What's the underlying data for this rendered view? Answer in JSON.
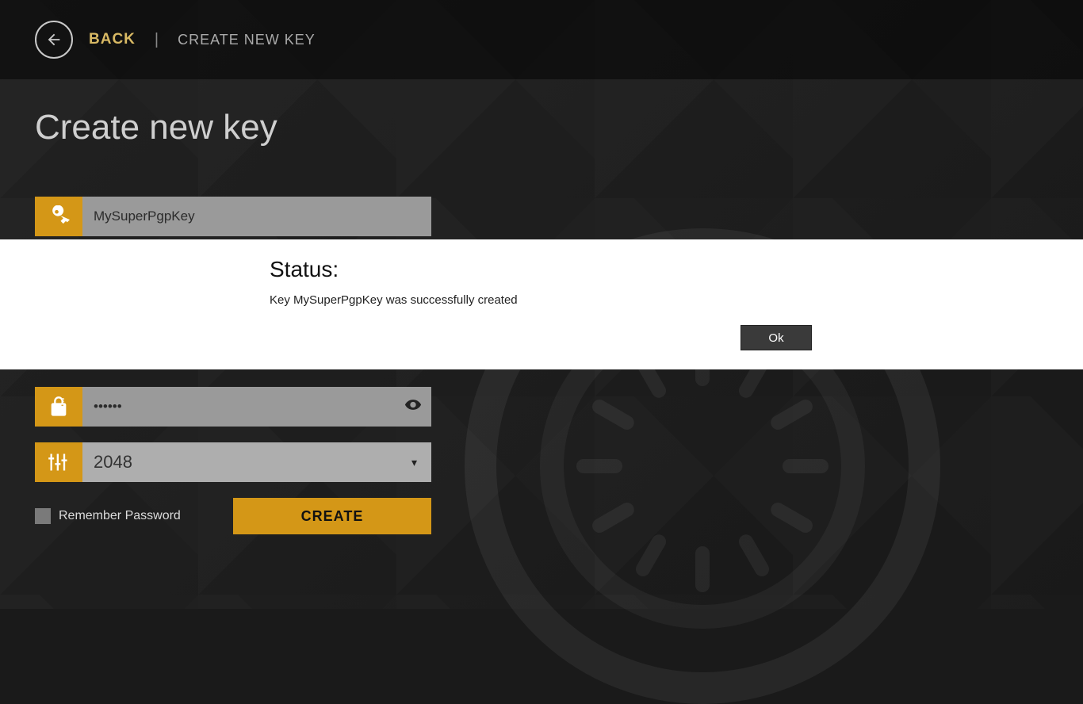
{
  "header": {
    "back_label": "BACK",
    "breadcrumb": "CREATE NEW KEY"
  },
  "page": {
    "title": "Create new key"
  },
  "form": {
    "name_value": "MySuperPgpKey",
    "confirm_pw_value": "••••••",
    "keysize_value": "2048",
    "remember_label": "Remember Password",
    "create_label": "CREATE"
  },
  "modal": {
    "title": "Status:",
    "body": "Key MySuperPgpKey was successfully created",
    "ok_label": "Ok"
  }
}
